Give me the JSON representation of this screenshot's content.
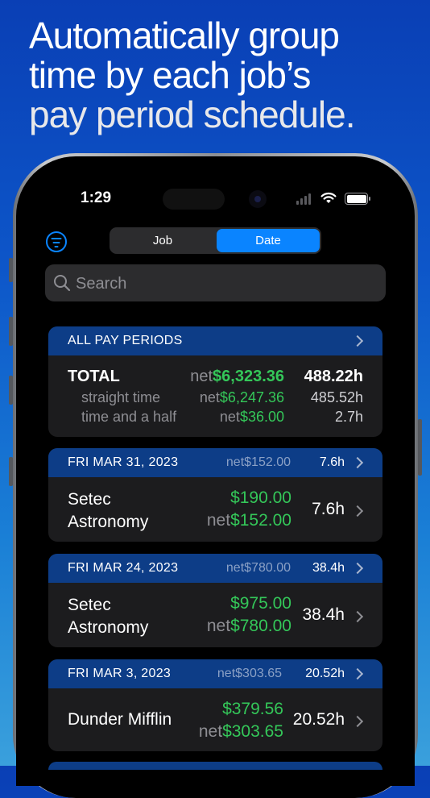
{
  "headline": [
    "Automatically group",
    "time by each job’s",
    "pay period schedule."
  ],
  "status": {
    "time": "1:29"
  },
  "segmented": {
    "job": "Job",
    "date": "Date",
    "selected": "Date"
  },
  "search": {
    "placeholder": "Search"
  },
  "summary": {
    "header": "ALL PAY PERIODS",
    "total_label": "TOTAL",
    "net_prefix": "net",
    "total_net": "$6,323.36",
    "total_hours": "488.22h",
    "rows": [
      {
        "label": "straight time",
        "net": "$6,247.36",
        "hours": "485.52h"
      },
      {
        "label": "time and a half",
        "net": "$36.00",
        "hours": "2.7h"
      }
    ]
  },
  "periods": [
    {
      "date": "FRI MAR 31, 2023",
      "net_prefix": "net",
      "net": "$152.00",
      "hours": "7.6h",
      "job_line1": "Setec",
      "job_line2": "Astronomy",
      "gross": "$190.00",
      "job_net": "$152.00",
      "job_hours": "7.6h"
    },
    {
      "date": "FRI MAR 24, 2023",
      "net_prefix": "net",
      "net": "$780.00",
      "hours": "38.4h",
      "job_line1": "Setec",
      "job_line2": "Astronomy",
      "gross": "$975.00",
      "job_net": "$780.00",
      "job_hours": "38.4h"
    },
    {
      "date": "FRI MAR 3, 2023",
      "net_prefix": "net",
      "net": "$303.65",
      "hours": "20.52h",
      "job_line1": "Dunder Mifflin",
      "job_line2": "",
      "gross": "$379.56",
      "job_net": "$303.65",
      "job_hours": "20.52h"
    }
  ],
  "colors": {
    "accent": "#0a84ff",
    "positive": "#34c759",
    "section_header": "#0d3d87",
    "card": "#1c1c1e"
  }
}
